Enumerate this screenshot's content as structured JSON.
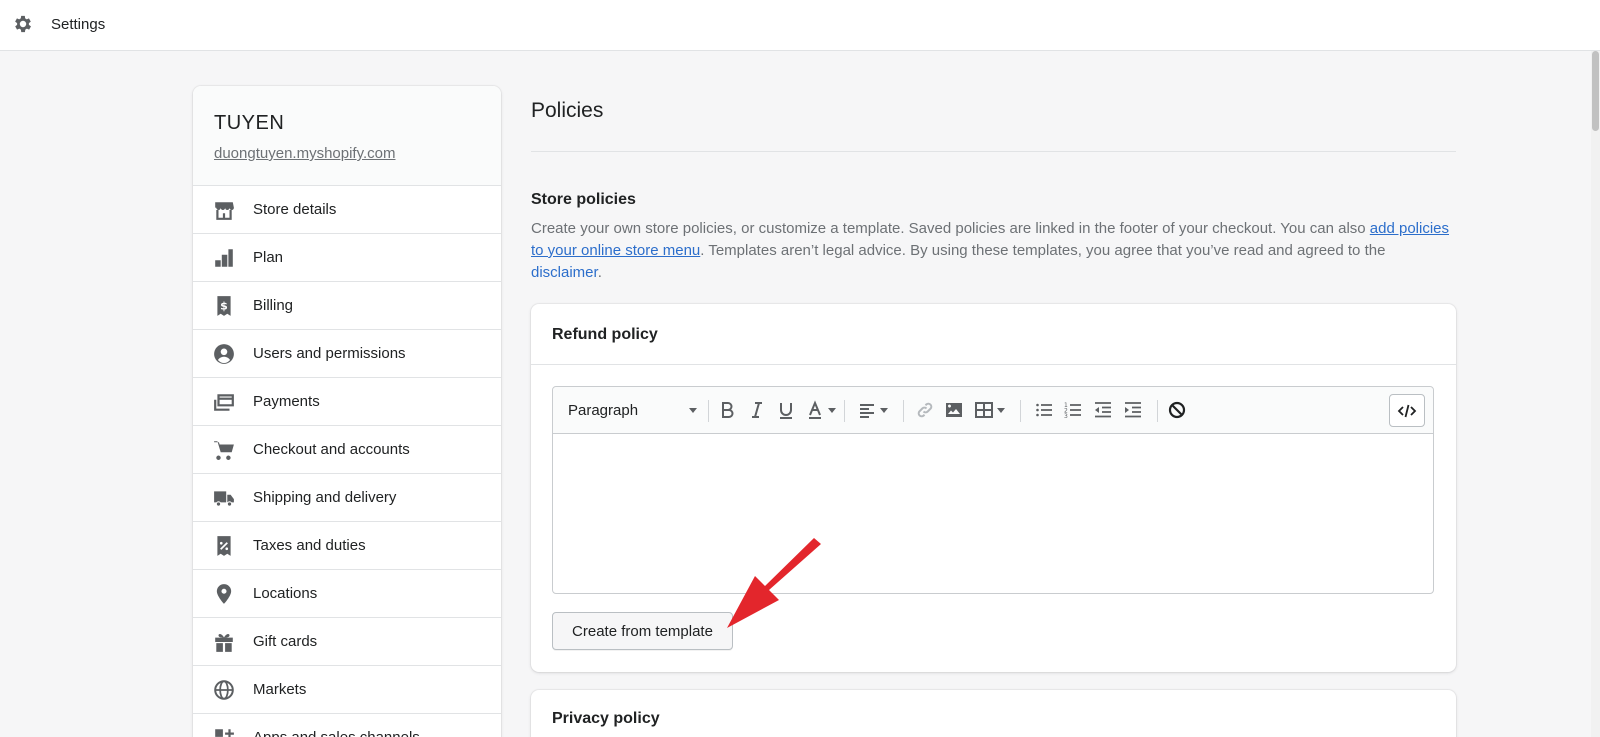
{
  "topbar": {
    "title": "Settings",
    "icon": "gear-icon"
  },
  "store": {
    "name": "TUYEN",
    "domain": "duongtuyen.myshopify.com"
  },
  "sidebar": {
    "items": [
      {
        "label": "Store details",
        "icon": "store-icon"
      },
      {
        "label": "Plan",
        "icon": "plan-icon"
      },
      {
        "label": "Billing",
        "icon": "billing-icon"
      },
      {
        "label": "Users and permissions",
        "icon": "user-icon"
      },
      {
        "label": "Payments",
        "icon": "payments-icon"
      },
      {
        "label": "Checkout and accounts",
        "icon": "cart-icon"
      },
      {
        "label": "Shipping and delivery",
        "icon": "truck-icon"
      },
      {
        "label": "Taxes and duties",
        "icon": "tax-icon"
      },
      {
        "label": "Locations",
        "icon": "location-icon"
      },
      {
        "label": "Gift cards",
        "icon": "gift-icon"
      },
      {
        "label": "Markets",
        "icon": "globe-icon"
      },
      {
        "label": "Apps and sales channels",
        "icon": "apps-icon"
      }
    ]
  },
  "main": {
    "title": "Policies",
    "store_policies": {
      "title": "Store policies",
      "desc_part1": "Create your own store policies, or customize a template. Saved policies are linked in the footer of your checkout. You can also ",
      "desc_link1": "add policies to your online store menu",
      "desc_part2": ". Templates aren’t legal advice. By using these templates, you agree that you’ve read and agreed to the ",
      "desc_link2": "disclaimer",
      "desc_part3": "."
    },
    "refund": {
      "title": "Refund policy",
      "paragraph_select": "Paragraph",
      "template_button": "Create from template"
    },
    "privacy": {
      "title": "Privacy policy"
    }
  },
  "colors": {
    "link": "#2c6ecb",
    "arrow": "#e3262c",
    "background": "#f6f6f7"
  }
}
